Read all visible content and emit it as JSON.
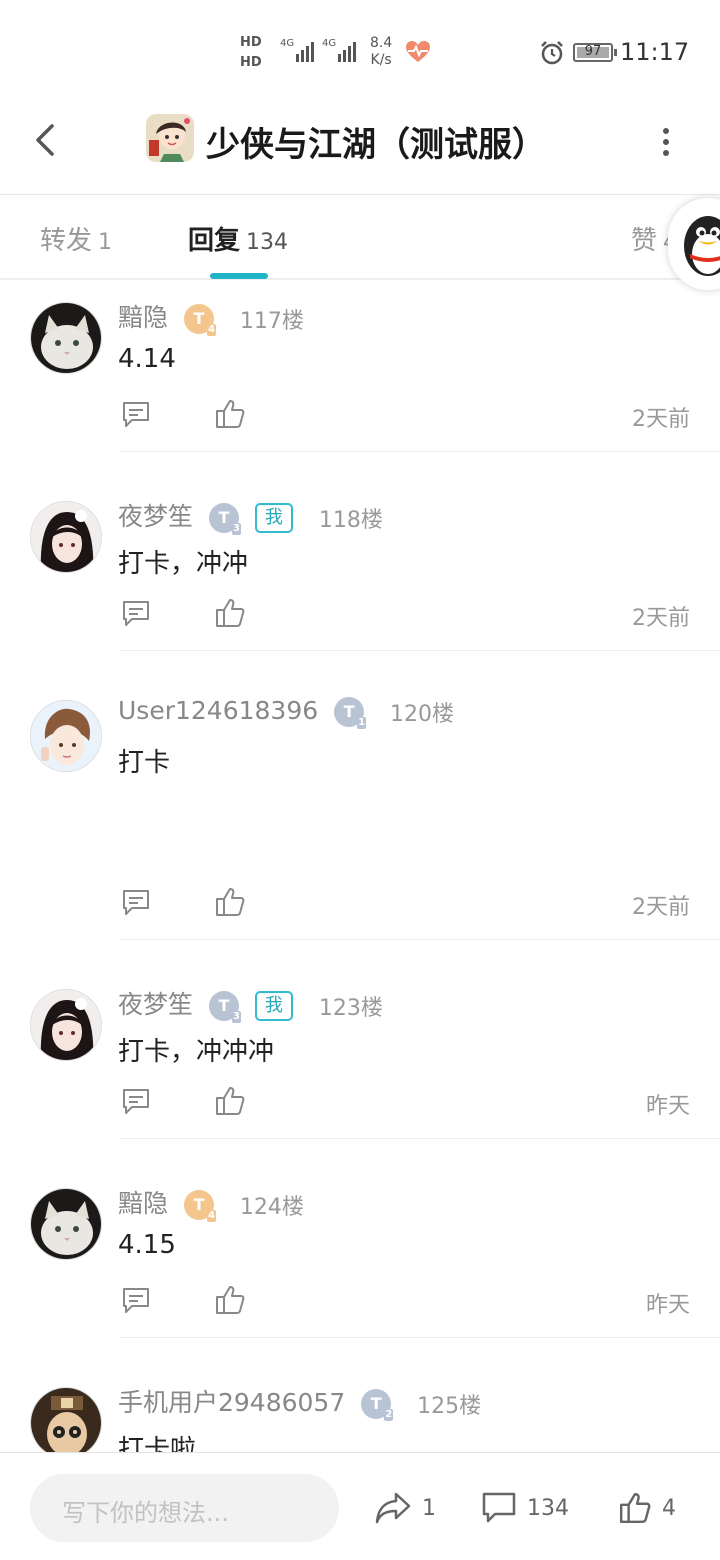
{
  "status_bar": {
    "hd1": "HD",
    "hd2": "HD",
    "net1": "4G",
    "net2": "4G",
    "speed_value": "8.4",
    "speed_unit": "K/s",
    "battery": "97",
    "time": "11:17"
  },
  "header": {
    "title": "少侠与江湖（测试服）"
  },
  "tabs": [
    {
      "label": "转发",
      "count": "1"
    },
    {
      "label": "回复",
      "count": "134"
    },
    {
      "label": "赞",
      "count": "4"
    }
  ],
  "replies": [
    {
      "name": "黯隐",
      "level": "4",
      "badge": "T",
      "is_me": false,
      "floor": "117楼",
      "content": "4.14",
      "time": "2天前"
    },
    {
      "name": "夜梦笙",
      "level": "3",
      "badge": "T",
      "is_me": true,
      "me_label": "我",
      "floor": "118楼",
      "content": "打卡，冲冲",
      "time": "2天前"
    },
    {
      "name": "User124618396",
      "level": "1",
      "badge": "T",
      "is_me": false,
      "floor": "120楼",
      "content": "打卡",
      "time": "2天前"
    },
    {
      "name": "夜梦笙",
      "level": "3",
      "badge": "T",
      "is_me": true,
      "me_label": "我",
      "floor": "123楼",
      "content": "打卡，冲冲冲",
      "time": "昨天"
    },
    {
      "name": "黯隐",
      "level": "4",
      "badge": "T",
      "is_me": false,
      "floor": "124楼",
      "content": "4.15",
      "time": "昨天"
    },
    {
      "name": "手机用户29486057",
      "level": "2",
      "badge": "T",
      "is_me": false,
      "floor": "125楼",
      "content": "打卡啦",
      "time": ""
    }
  ],
  "bottom_bar": {
    "input_placeholder": "写下你的想法...",
    "share_count": "1",
    "comment_count": "134",
    "like_count": "4"
  },
  "colors": {
    "accent": "#20b4c6",
    "gold_badge": "#f4c68d",
    "silver_badge": "#b8c3d3"
  }
}
